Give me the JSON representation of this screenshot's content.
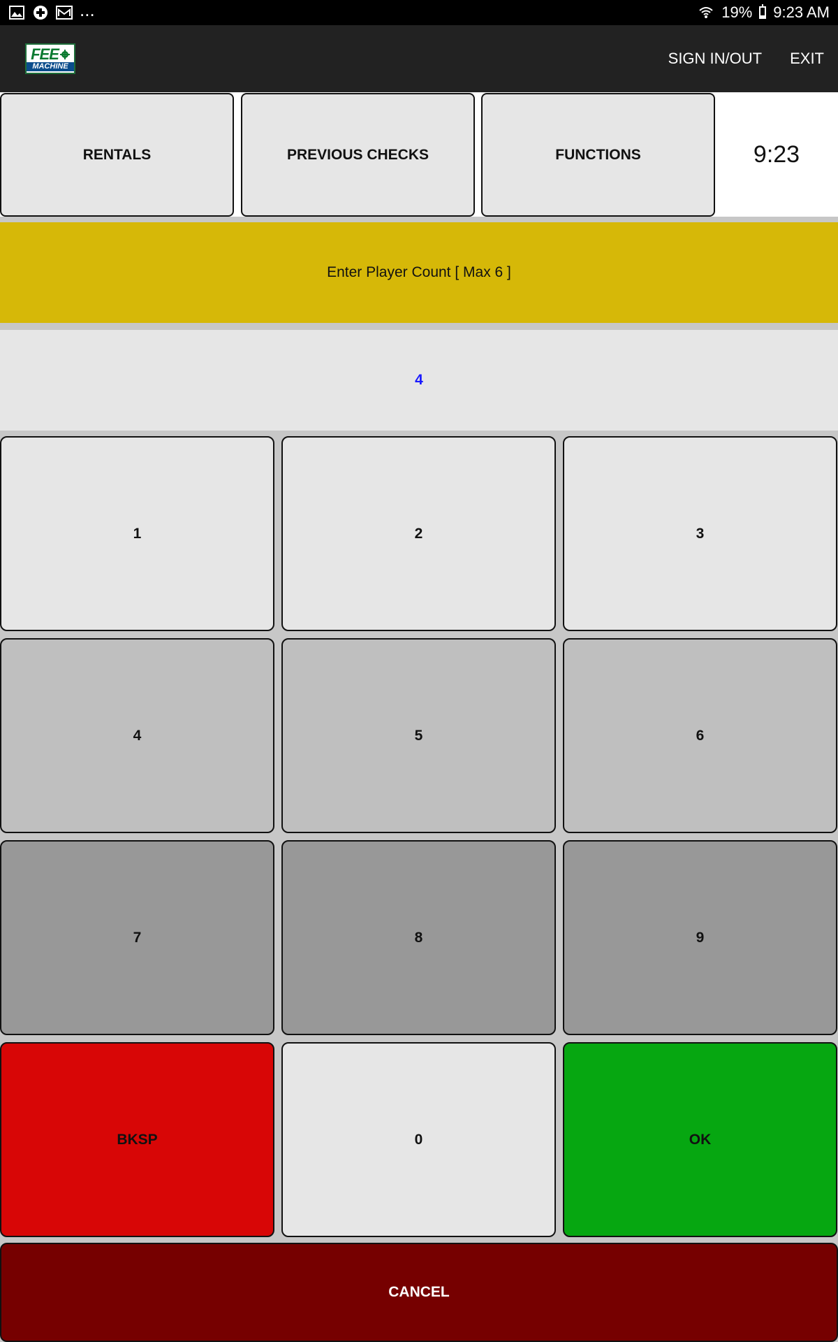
{
  "status_bar": {
    "battery": "19%",
    "time": "9:23 AM",
    "overflow": "...",
    "icons": [
      "image-icon",
      "plus-circle-icon",
      "mail-icon",
      "wifi-icon",
      "battery-icon"
    ]
  },
  "header": {
    "logo": {
      "top": "FEE",
      "bottom": "MACHINE"
    },
    "sign_in_out": "SIGN IN/OUT",
    "exit": "EXIT"
  },
  "tabs": {
    "rentals": "RENTALS",
    "previous_checks": "PREVIOUS CHECKS",
    "functions": "FUNCTIONS",
    "clock": "9:23"
  },
  "prompt": "Enter Player Count [ Max 6 ]",
  "entry_value": "4",
  "keypad": {
    "k1": "1",
    "k2": "2",
    "k3": "3",
    "k4": "4",
    "k5": "5",
    "k6": "6",
    "k7": "7",
    "k8": "8",
    "k9": "9",
    "bksp": "BKSP",
    "k0": "0",
    "ok": "OK"
  },
  "cancel": "CANCEL",
  "colors": {
    "prompt_bg": "#d6b808",
    "bksp_bg": "#d80606",
    "ok_bg": "#06a711",
    "cancel_bg": "#760000",
    "entry_text": "#1a1aff"
  }
}
